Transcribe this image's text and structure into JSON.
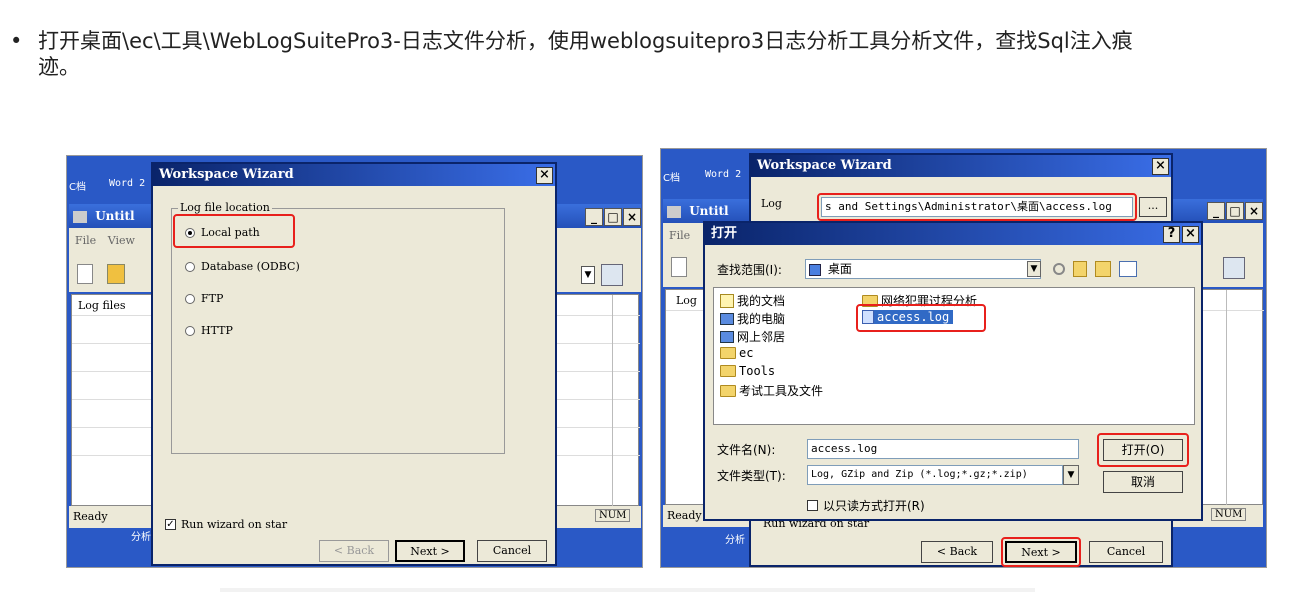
{
  "instruction": {
    "bullet": "•",
    "text": "打开桌面\\ec\\工具\\WebLogSuitePro3-日志文件分析，使用weblogsuitepro3日志分析工具分析文件，查找Sql注入痕迹。"
  },
  "left_shot": {
    "desktop_label_1": "C档",
    "desktop_label_2": "Word 2",
    "app_title": "Untitl",
    "menu_file": "File",
    "menu_view": "View",
    "col_log_files": "Log files",
    "status_ready": "Ready",
    "status_num": "NUM",
    "taskbar_text": "分析",
    "dialog": {
      "title": "Workspace Wizard",
      "close": "×",
      "group_label": "Log file location",
      "options": [
        {
          "label": "Local path",
          "selected": true
        },
        {
          "label": "Database (ODBC)",
          "selected": false
        },
        {
          "label": "FTP",
          "selected": false
        },
        {
          "label": "HTTP",
          "selected": false
        }
      ],
      "run_wizard_label": "Run wizard on star",
      "run_wizard_checked": "✓",
      "back_label": "< Back",
      "next_label": "Next >",
      "cancel_label": "Cancel"
    }
  },
  "right_shot": {
    "desktop_label_1": "C档",
    "desktop_label_2": "Word 2",
    "app_title": "Untitl",
    "menu_file": "File",
    "col_log": "Log",
    "status_ready": "Ready",
    "status_num": "NUM",
    "taskbar_text": "分析",
    "wizard": {
      "title": "Workspace Wizard",
      "close": "×",
      "log_label": "Log",
      "log_path": "s and Settings\\Administrator\\桌面\\access.log",
      "browse": "...",
      "run_wizard_label": "Run wizard on star",
      "back_label": "< Back",
      "next_label": "Next >",
      "cancel_label": "Cancel"
    },
    "open_dialog": {
      "title": "打开",
      "help": "?",
      "close": "×",
      "lookin_label": "查找范围(I):",
      "lookin_value": "桌面",
      "left_items": [
        "我的文档",
        "我的电脑",
        "网上邻居",
        "ec",
        "Tools",
        "考试工具及文件"
      ],
      "right_items": [
        "网络犯罪过程分析",
        "access.log"
      ],
      "filename_label": "文件名(N):",
      "filename_value": "access.log",
      "filetype_label": "文件类型(T):",
      "filetype_value": "Log, GZip and Zip (*.log;*.gz;*.zip)",
      "readonly_label": "以只读方式打开(R)",
      "open_button": "打开(O)",
      "cancel_button": "取消"
    }
  },
  "colors": {
    "highlight": "#e8201c",
    "title_bar": "#0a246a",
    "dialog_bg": "#ece9d8",
    "desktop": "#2a59c6"
  }
}
